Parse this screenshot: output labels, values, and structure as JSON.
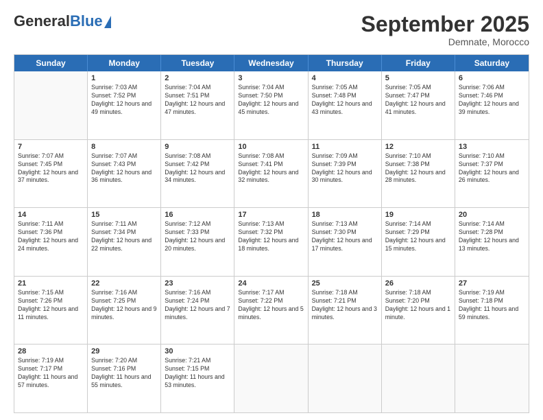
{
  "header": {
    "logo_general": "General",
    "logo_blue": "Blue",
    "month_title": "September 2025",
    "location": "Demnate, Morocco"
  },
  "days_of_week": [
    "Sunday",
    "Monday",
    "Tuesday",
    "Wednesday",
    "Thursday",
    "Friday",
    "Saturday"
  ],
  "weeks": [
    [
      {
        "day": "",
        "empty": true
      },
      {
        "day": "1",
        "sunrise": "Sunrise: 7:03 AM",
        "sunset": "Sunset: 7:52 PM",
        "daylight": "Daylight: 12 hours and 49 minutes."
      },
      {
        "day": "2",
        "sunrise": "Sunrise: 7:04 AM",
        "sunset": "Sunset: 7:51 PM",
        "daylight": "Daylight: 12 hours and 47 minutes."
      },
      {
        "day": "3",
        "sunrise": "Sunrise: 7:04 AM",
        "sunset": "Sunset: 7:50 PM",
        "daylight": "Daylight: 12 hours and 45 minutes."
      },
      {
        "day": "4",
        "sunrise": "Sunrise: 7:05 AM",
        "sunset": "Sunset: 7:48 PM",
        "daylight": "Daylight: 12 hours and 43 minutes."
      },
      {
        "day": "5",
        "sunrise": "Sunrise: 7:05 AM",
        "sunset": "Sunset: 7:47 PM",
        "daylight": "Daylight: 12 hours and 41 minutes."
      },
      {
        "day": "6",
        "sunrise": "Sunrise: 7:06 AM",
        "sunset": "Sunset: 7:46 PM",
        "daylight": "Daylight: 12 hours and 39 minutes."
      }
    ],
    [
      {
        "day": "7",
        "sunrise": "Sunrise: 7:07 AM",
        "sunset": "Sunset: 7:45 PM",
        "daylight": "Daylight: 12 hours and 37 minutes."
      },
      {
        "day": "8",
        "sunrise": "Sunrise: 7:07 AM",
        "sunset": "Sunset: 7:43 PM",
        "daylight": "Daylight: 12 hours and 36 minutes."
      },
      {
        "day": "9",
        "sunrise": "Sunrise: 7:08 AM",
        "sunset": "Sunset: 7:42 PM",
        "daylight": "Daylight: 12 hours and 34 minutes."
      },
      {
        "day": "10",
        "sunrise": "Sunrise: 7:08 AM",
        "sunset": "Sunset: 7:41 PM",
        "daylight": "Daylight: 12 hours and 32 minutes."
      },
      {
        "day": "11",
        "sunrise": "Sunrise: 7:09 AM",
        "sunset": "Sunset: 7:39 PM",
        "daylight": "Daylight: 12 hours and 30 minutes."
      },
      {
        "day": "12",
        "sunrise": "Sunrise: 7:10 AM",
        "sunset": "Sunset: 7:38 PM",
        "daylight": "Daylight: 12 hours and 28 minutes."
      },
      {
        "day": "13",
        "sunrise": "Sunrise: 7:10 AM",
        "sunset": "Sunset: 7:37 PM",
        "daylight": "Daylight: 12 hours and 26 minutes."
      }
    ],
    [
      {
        "day": "14",
        "sunrise": "Sunrise: 7:11 AM",
        "sunset": "Sunset: 7:36 PM",
        "daylight": "Daylight: 12 hours and 24 minutes."
      },
      {
        "day": "15",
        "sunrise": "Sunrise: 7:11 AM",
        "sunset": "Sunset: 7:34 PM",
        "daylight": "Daylight: 12 hours and 22 minutes."
      },
      {
        "day": "16",
        "sunrise": "Sunrise: 7:12 AM",
        "sunset": "Sunset: 7:33 PM",
        "daylight": "Daylight: 12 hours and 20 minutes."
      },
      {
        "day": "17",
        "sunrise": "Sunrise: 7:13 AM",
        "sunset": "Sunset: 7:32 PM",
        "daylight": "Daylight: 12 hours and 18 minutes."
      },
      {
        "day": "18",
        "sunrise": "Sunrise: 7:13 AM",
        "sunset": "Sunset: 7:30 PM",
        "daylight": "Daylight: 12 hours and 17 minutes."
      },
      {
        "day": "19",
        "sunrise": "Sunrise: 7:14 AM",
        "sunset": "Sunset: 7:29 PM",
        "daylight": "Daylight: 12 hours and 15 minutes."
      },
      {
        "day": "20",
        "sunrise": "Sunrise: 7:14 AM",
        "sunset": "Sunset: 7:28 PM",
        "daylight": "Daylight: 12 hours and 13 minutes."
      }
    ],
    [
      {
        "day": "21",
        "sunrise": "Sunrise: 7:15 AM",
        "sunset": "Sunset: 7:26 PM",
        "daylight": "Daylight: 12 hours and 11 minutes."
      },
      {
        "day": "22",
        "sunrise": "Sunrise: 7:16 AM",
        "sunset": "Sunset: 7:25 PM",
        "daylight": "Daylight: 12 hours and 9 minutes."
      },
      {
        "day": "23",
        "sunrise": "Sunrise: 7:16 AM",
        "sunset": "Sunset: 7:24 PM",
        "daylight": "Daylight: 12 hours and 7 minutes."
      },
      {
        "day": "24",
        "sunrise": "Sunrise: 7:17 AM",
        "sunset": "Sunset: 7:22 PM",
        "daylight": "Daylight: 12 hours and 5 minutes."
      },
      {
        "day": "25",
        "sunrise": "Sunrise: 7:18 AM",
        "sunset": "Sunset: 7:21 PM",
        "daylight": "Daylight: 12 hours and 3 minutes."
      },
      {
        "day": "26",
        "sunrise": "Sunrise: 7:18 AM",
        "sunset": "Sunset: 7:20 PM",
        "daylight": "Daylight: 12 hours and 1 minute."
      },
      {
        "day": "27",
        "sunrise": "Sunrise: 7:19 AM",
        "sunset": "Sunset: 7:18 PM",
        "daylight": "Daylight: 11 hours and 59 minutes."
      }
    ],
    [
      {
        "day": "28",
        "sunrise": "Sunrise: 7:19 AM",
        "sunset": "Sunset: 7:17 PM",
        "daylight": "Daylight: 11 hours and 57 minutes."
      },
      {
        "day": "29",
        "sunrise": "Sunrise: 7:20 AM",
        "sunset": "Sunset: 7:16 PM",
        "daylight": "Daylight: 11 hours and 55 minutes."
      },
      {
        "day": "30",
        "sunrise": "Sunrise: 7:21 AM",
        "sunset": "Sunset: 7:15 PM",
        "daylight": "Daylight: 11 hours and 53 minutes."
      },
      {
        "day": "",
        "empty": true
      },
      {
        "day": "",
        "empty": true
      },
      {
        "day": "",
        "empty": true
      },
      {
        "day": "",
        "empty": true
      }
    ]
  ]
}
